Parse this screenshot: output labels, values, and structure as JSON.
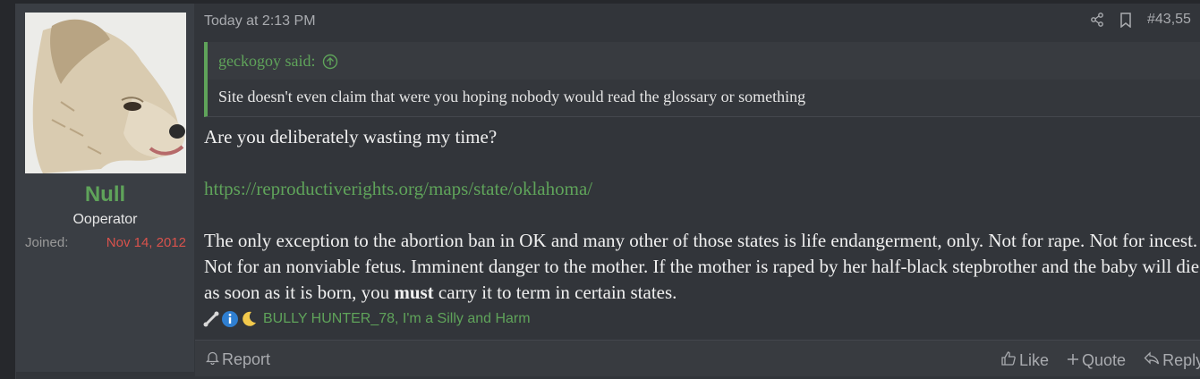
{
  "user": {
    "name": "Null",
    "title": "Ooperator",
    "joined_label": "Joined:",
    "joined_value": "Nov 14, 2012"
  },
  "post": {
    "timestamp": "Today at 2:13 PM",
    "number": "#43,55"
  },
  "quote": {
    "author": "geckogoy said:",
    "text": "Site doesn't even claim that were you hoping nobody would read the glossary or something"
  },
  "body": {
    "line1": "Are you deliberately wasting my time?",
    "link": "https://reproductiverights.org/maps/state/oklahoma/",
    "para_before_bold": "The only exception to the abortion ban in OK and many other of those states is life endangerment, only. Not for rape. Not for incest. Not for an nonviable fetus. Imminent danger to the mother. If the mother is raped by her half-black stepbrother and the baby will die as soon as it is born, you ",
    "bold": "must",
    "para_after_bold": " carry it to term in certain states."
  },
  "reactions": {
    "names": "BULLY HUNTER_78, I'm a Silly and Harm"
  },
  "footer": {
    "report": "Report",
    "like": "Like",
    "quote": "Quote",
    "reply": "Reply"
  },
  "colors": {
    "accent": "#5fa35a",
    "joined": "#d8524c",
    "post_bg": "#32353a"
  }
}
